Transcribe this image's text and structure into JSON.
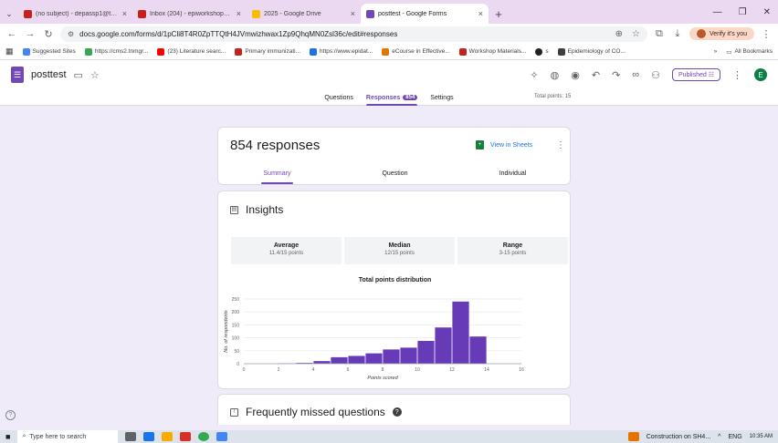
{
  "browser": {
    "tabs": [
      {
        "title": "(no subject) - depassp1@tnmgrmu",
        "icon_color": "#c5221f",
        "icon": "gmail-icon"
      },
      {
        "title": "Inbox (204) - epiworkshop@tnmg",
        "icon_color": "#c5221f",
        "icon": "gmail-icon"
      },
      {
        "title": "2025 - Google Drive",
        "icon_color": "#fbbc04",
        "icon": "drive-icon"
      },
      {
        "title": "posttest - Google Forms",
        "icon_color": "#7248b9",
        "icon": "forms-icon"
      }
    ],
    "url": "docs.google.com/forms/d/1pCli8T4R0ZpTTQtH4JVmwizhwax1Zp9QhqMN0Zsl36c/edit#responses",
    "verify_label": "Verify it's you",
    "bookmarks": [
      "Suggested Sites",
      "https://cms2.tnmgr...",
      "(23) Literature searc...",
      "Primary immunizati...",
      "https://www.epidat...",
      "eCourse in Effective...",
      "Workshop Materials...",
      "s",
      "Epidemiology of CO..."
    ],
    "all_bookmarks": "All Bookmarks",
    "more_bookmarks": "»"
  },
  "form": {
    "title": "posttest",
    "published_label": "Published",
    "user_initial": "E",
    "tabs": {
      "questions": "Questions",
      "responses": "Responses",
      "responses_count": "854",
      "settings": "Settings"
    },
    "total_points": "Total points: 15"
  },
  "responses": {
    "title": "854 responses",
    "view_in_sheets": "View in Sheets",
    "subtabs": {
      "summary": "Summary",
      "question": "Question",
      "individual": "Individual"
    }
  },
  "insights": {
    "title": "Insights",
    "stats": [
      {
        "label": "Average",
        "value": "11.4/15 points"
      },
      {
        "label": "Median",
        "value": "12/15 points"
      },
      {
        "label": "Range",
        "value": "3-15 points"
      }
    ]
  },
  "missed": {
    "title": "Frequently missed questions"
  },
  "taskbar": {
    "search_placeholder": "Type here to search",
    "notification": "Construction on SH4...",
    "lang": "ENG",
    "time": "10:35 AM"
  },
  "chart_data": {
    "type": "bar",
    "title": "Total points distribution",
    "xlabel": "Points scored",
    "ylabel": "No. of respondents",
    "x": [
      3,
      4,
      5,
      6,
      7,
      8,
      9,
      10,
      11,
      12,
      13,
      14,
      15
    ],
    "values": [
      1,
      3,
      10,
      25,
      30,
      40,
      55,
      62,
      88,
      140,
      240,
      105,
      0
    ],
    "xticks": [
      0,
      2,
      4,
      6,
      8,
      10,
      12,
      14,
      16
    ],
    "yticks": [
      0,
      50,
      100,
      150,
      200,
      250
    ],
    "xlim": [
      0,
      16
    ],
    "ylim": [
      0,
      250
    ],
    "color": "#673ab7",
    "grid": true
  }
}
